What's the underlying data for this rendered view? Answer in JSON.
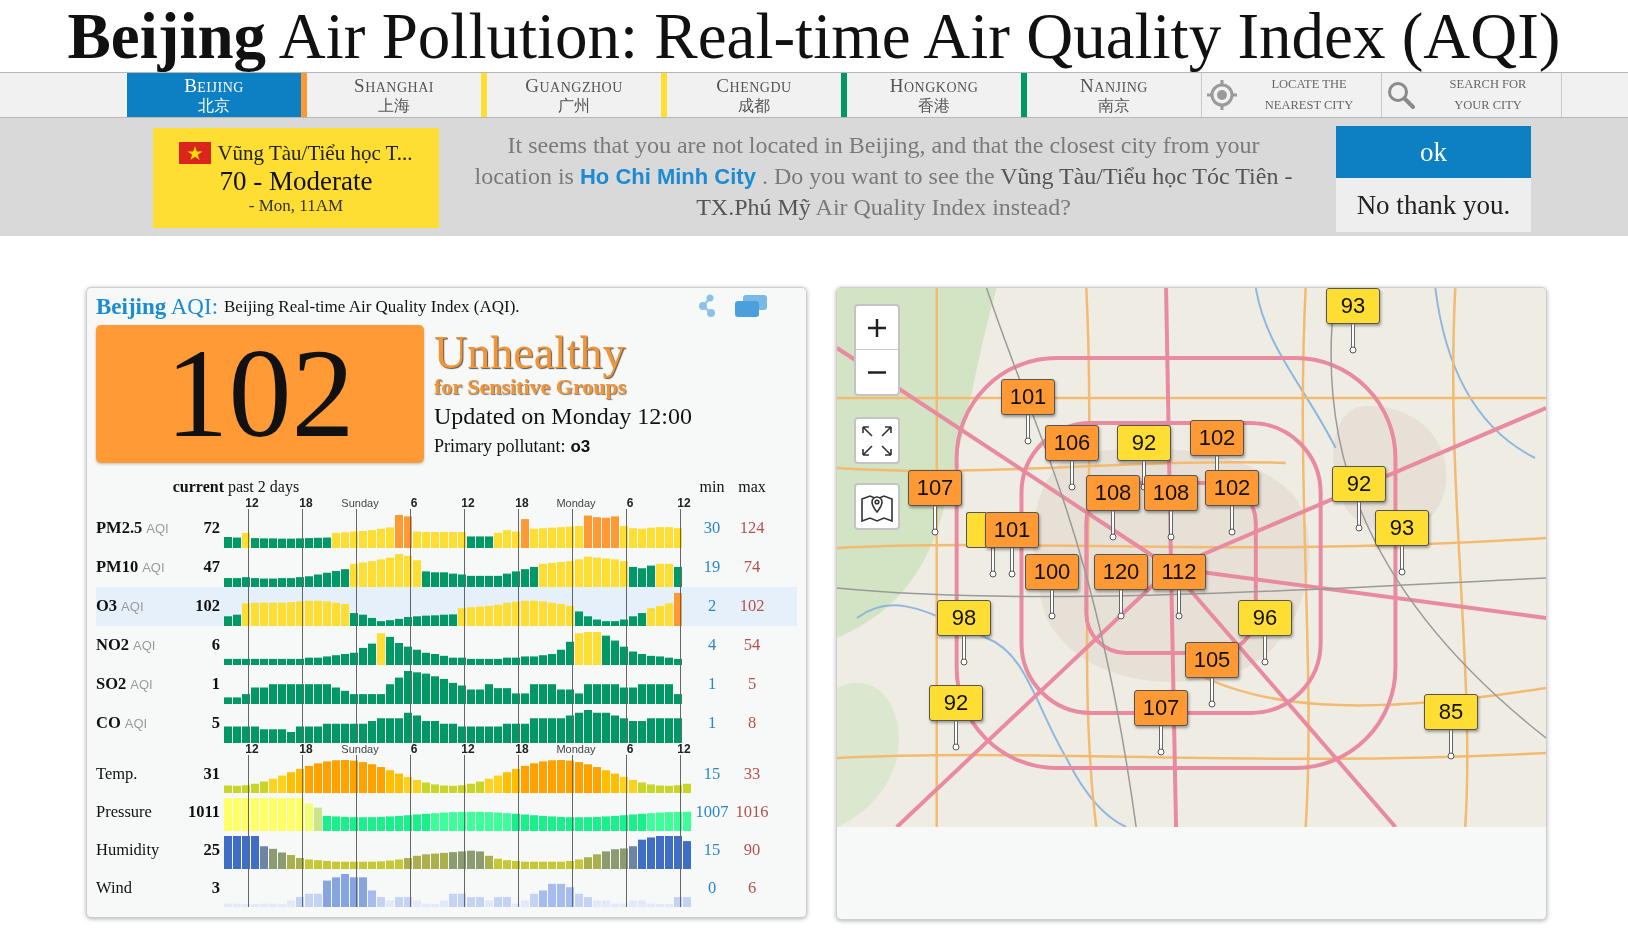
{
  "page_title": "**Beijing** Air Pollution: Real-time Air Quality Index (AQI)",
  "nav": {
    "tabs": [
      {
        "name": "BEIJING",
        "native": "北京",
        "selected": true,
        "color": "#ff9933"
      },
      {
        "name": "SHANGHAI",
        "native": "上海",
        "selected": false,
        "color": "#ffde33"
      },
      {
        "name": "GUANGZHOU",
        "native": "广州",
        "selected": false,
        "color": "#ffde33"
      },
      {
        "name": "CHENGDU",
        "native": "成都",
        "selected": false,
        "color": "#009966"
      },
      {
        "name": "HONGKONG",
        "native": "香港",
        "selected": false,
        "color": "#009966"
      },
      {
        "name": "NANJING",
        "native": "南京",
        "selected": false
      }
    ],
    "tools": [
      {
        "kind": "locate",
        "label": "LOCATE THE NEAREST CITY"
      },
      {
        "kind": "search",
        "label": "SEARCH FOR YOUR CITY"
      }
    ]
  },
  "location_banner": {
    "station": {
      "name": "Vũng Tàu/Tiểu học T...",
      "reading": "70 - Moderate",
      "time": "- Mon, 11AM"
    },
    "message": {
      "intro": "It seems that you are not located in Beijing, and that the closest city from your location is",
      "link": "Ho Chi Minh City",
      "middle": ". Do you want to see the",
      "station": "Vũng Tàu/Tiểu học Tóc Tiên - TX.Phú Mỹ",
      "outro": "Air Quality Index instead?"
    },
    "buttons": [
      {
        "label": "ok",
        "kind": "primary"
      },
      {
        "label": "No thank you.",
        "kind": "secondary"
      }
    ]
  },
  "aqi_panel": {
    "heading": "**Beijing** AQI:",
    "subtitle": "Beijing Real-time Air Quality Index (AQI).",
    "aqi": "102",
    "category": "Unhealthy",
    "category_note": "for Sensitive Groups",
    "updated": "Updated on Monday 12:00",
    "pollutant_label": "Primary pollutant:",
    "pollutant": "o3",
    "history": {
      "current_header": "current",
      "period_header": "past 2 days",
      "min_header": "min",
      "max_header": "max",
      "time_axis": [
        {
          "label": "12",
          "kind": "hour"
        },
        {
          "label": "18",
          "kind": "hour"
        },
        {
          "label": "Sunday",
          "kind": "day"
        },
        {
          "label": "6",
          "kind": "hour"
        },
        {
          "label": "12",
          "kind": "hour"
        },
        {
          "label": "18",
          "kind": "hour"
        },
        {
          "label": "Monday",
          "kind": "day"
        },
        {
          "label": "6",
          "kind": "hour"
        },
        {
          "label": "12",
          "kind": "hour"
        }
      ],
      "pollutant_rows": [
        {
          "name": "PM2.5",
          "unit": "AQI",
          "current": "72",
          "min": "30",
          "max": "124",
          "selected": false
        },
        {
          "name": "PM10",
          "unit": "AQI",
          "current": "47",
          "min": "19",
          "max": "74",
          "selected": false
        },
        {
          "name": "O3",
          "unit": "AQI",
          "current": "102",
          "min": "2",
          "max": "102",
          "selected": true
        },
        {
          "name": "NO2",
          "unit": "AQI",
          "current": "6",
          "min": "4",
          "max": "54",
          "selected": false
        },
        {
          "name": "SO2",
          "unit": "AQI",
          "current": "1",
          "min": "1",
          "max": "5",
          "selected": false
        },
        {
          "name": "CO",
          "unit": "AQI",
          "current": "5",
          "min": "1",
          "max": "8",
          "selected": false
        }
      ],
      "weather_axis": [
        {
          "label": "12",
          "kind": "hour"
        },
        {
          "label": "18",
          "kind": "hour"
        },
        {
          "label": "Sunday",
          "kind": "day"
        },
        {
          "label": "6",
          "kind": "hour"
        },
        {
          "label": "12",
          "kind": "hour"
        },
        {
          "label": "18",
          "kind": "hour"
        },
        {
          "label": "Monday",
          "kind": "day"
        },
        {
          "label": "6",
          "kind": "hour"
        },
        {
          "label": "12",
          "kind": "hour"
        }
      ],
      "weather_rows": [
        {
          "kind": "temperature",
          "name": "Temp.",
          "current": "31",
          "min": "15",
          "max": "33",
          "selected": false
        },
        {
          "kind": "pressure",
          "name": "Pressure",
          "current": "1011",
          "min": "1007",
          "max": "1016",
          "selected": false
        },
        {
          "kind": "humidity",
          "name": "Humidity",
          "current": "25",
          "min": "15",
          "max": "90",
          "selected": false
        },
        {
          "kind": "wind",
          "name": "Wind",
          "current": "3",
          "min": "0",
          "max": "6",
          "selected": false
        }
      ]
    }
  },
  "map": {
    "markers": [
      {
        "value": "93",
        "color": "#ffde33"
      },
      {
        "value": "101",
        "color": "#ff9933"
      },
      {
        "value": "106",
        "color": "#ff9933"
      },
      {
        "value": "92",
        "color": "#ffde33"
      },
      {
        "value": "102",
        "color": "#ff9933"
      },
      {
        "value": "107",
        "color": "#ff9933"
      },
      {
        "value": "108",
        "color": "#ff9933"
      },
      {
        "value": "108",
        "color": "#ff9933"
      },
      {
        "value": "102",
        "color": "#ff9933"
      },
      {
        "value": "92",
        "color": "#ffde33"
      },
      {
        "color": "#ffde33"
      },
      {
        "value": "101",
        "color": "#ff9933"
      },
      {
        "value": "93",
        "color": "#ffde33"
      },
      {
        "value": "100",
        "color": "#ff9933"
      },
      {
        "value": "120",
        "color": "#ff9933"
      },
      {
        "value": "112",
        "color": "#ff9933"
      },
      {
        "value": "98",
        "color": "#ffde33"
      },
      {
        "value": "96",
        "color": "#ffde33"
      },
      {
        "value": "105",
        "color": "#ff9933"
      },
      {
        "value": "92",
        "color": "#ffde33"
      },
      {
        "value": "107",
        "color": "#ff9933"
      },
      {
        "value": "85",
        "color": "#ffde33"
      }
    ]
  }
}
